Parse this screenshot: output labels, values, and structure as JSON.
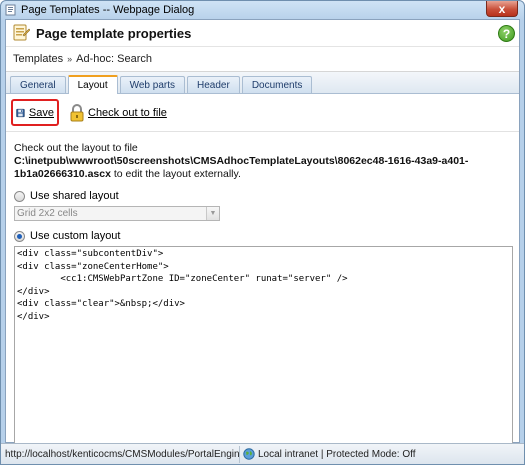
{
  "window": {
    "title": "Page Templates -- Webpage Dialog",
    "close_glyph": "x"
  },
  "header": {
    "title": "Page template properties",
    "help_glyph": "?"
  },
  "breadcrumb": {
    "items": [
      "Templates",
      "Ad-hoc: Search"
    ],
    "separator": "»"
  },
  "tabs": [
    {
      "label": "General",
      "active": false
    },
    {
      "label": "Layout",
      "active": true
    },
    {
      "label": "Web parts",
      "active": false
    },
    {
      "label": "Header",
      "active": false
    },
    {
      "label": "Documents",
      "active": false
    }
  ],
  "toolbar": {
    "save_label": "Save",
    "checkout_label": "Check out to file"
  },
  "content": {
    "info_prefix": "Check out the layout to file ",
    "info_path": "C:\\inetpub\\wwwroot\\50screenshots\\CMSAdhocTemplateLayouts\\8062ec48-1616-43a9-a401-1b1a02666310.ascx",
    "info_suffix": " to edit the layout externally.",
    "shared_layout_label": "Use shared layout",
    "shared_layout_selected": false,
    "shared_layout_value": "Grid 2x2 cells",
    "custom_layout_label": "Use custom layout",
    "custom_layout_selected": true,
    "layout_code": "<div class=\"subcontentDiv\">\n<div class=\"zoneCenterHome\">\n        <cc1:CMSWebPartZone ID=\"zoneCenter\" runat=\"server\" />\n</div>\n<div class=\"clear\">&nbsp;</div>\n</div>"
  },
  "statusbar": {
    "url": "http://localhost/kenticocms/CMSModules/PortalEngine/UI/Pa",
    "zone": "Local intranet | Protected Mode: Off"
  },
  "colors": {
    "accent_tab": "#f0a020",
    "save_highlight": "#e02020",
    "link": "#1f3d6b"
  },
  "icons": {
    "app": "page-templates-icon",
    "header": "page-template-icon",
    "help": "help-icon",
    "save": "floppy-disk-icon",
    "checkout": "lock-icon",
    "zone": "globe-icon"
  }
}
